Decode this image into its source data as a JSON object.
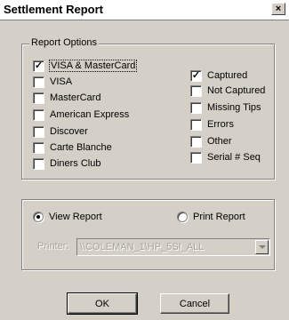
{
  "window": {
    "title": "Settlement Report",
    "close_glyph": "×"
  },
  "report_options": {
    "label": "Report Options",
    "card_types": [
      {
        "label": "VISA & MasterCard",
        "checked": true
      },
      {
        "label": "VISA",
        "checked": false
      },
      {
        "label": "MasterCard",
        "checked": false
      },
      {
        "label": "American Express",
        "checked": false
      },
      {
        "label": "Discover",
        "checked": false
      },
      {
        "label": "Carte Blanche",
        "checked": false
      },
      {
        "label": "Diners Club",
        "checked": false
      }
    ],
    "statuses": [
      {
        "label": "Captured",
        "checked": true
      },
      {
        "label": "Not Captured",
        "checked": false
      },
      {
        "label": "Missing Tips",
        "checked": false
      },
      {
        "label": "Errors",
        "checked": false
      },
      {
        "label": "Other",
        "checked": false
      },
      {
        "label": "Serial # Seq",
        "checked": false
      }
    ]
  },
  "output": {
    "view_report": {
      "label": "View Report",
      "selected": true
    },
    "print_report": {
      "label": "Print Report",
      "selected": false
    },
    "printer_label": "Printer:",
    "printer_value": "\\\\COLEMAN_1\\HP_5SI_ALL"
  },
  "buttons": {
    "ok": "OK",
    "cancel": "Cancel"
  },
  "glyphs": {
    "check": "✓"
  }
}
